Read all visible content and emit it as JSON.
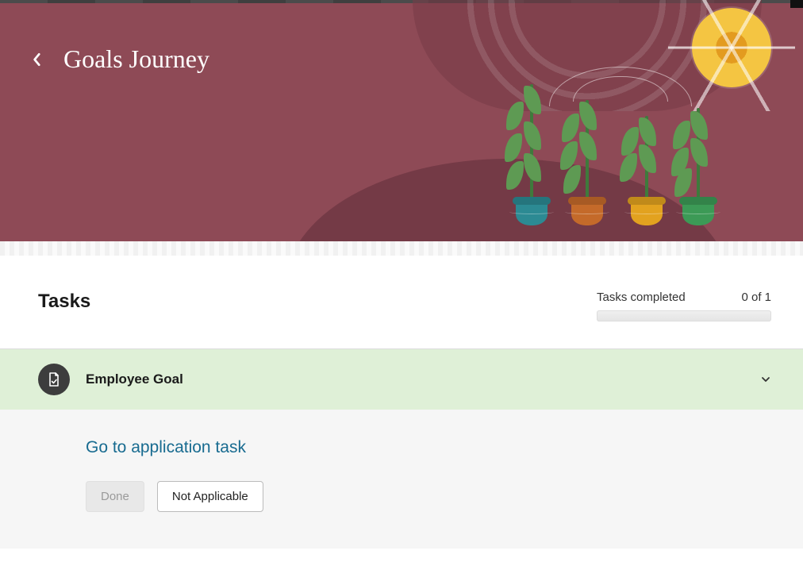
{
  "header": {
    "title": "Goals Journey"
  },
  "tasks": {
    "heading": "Tasks",
    "progress_label": "Tasks completed",
    "progress_value": "0 of 1"
  },
  "task": {
    "title": "Employee Goal",
    "link_label": "Go to application task",
    "done_label": "Done",
    "not_applicable_label": "Not Applicable"
  }
}
